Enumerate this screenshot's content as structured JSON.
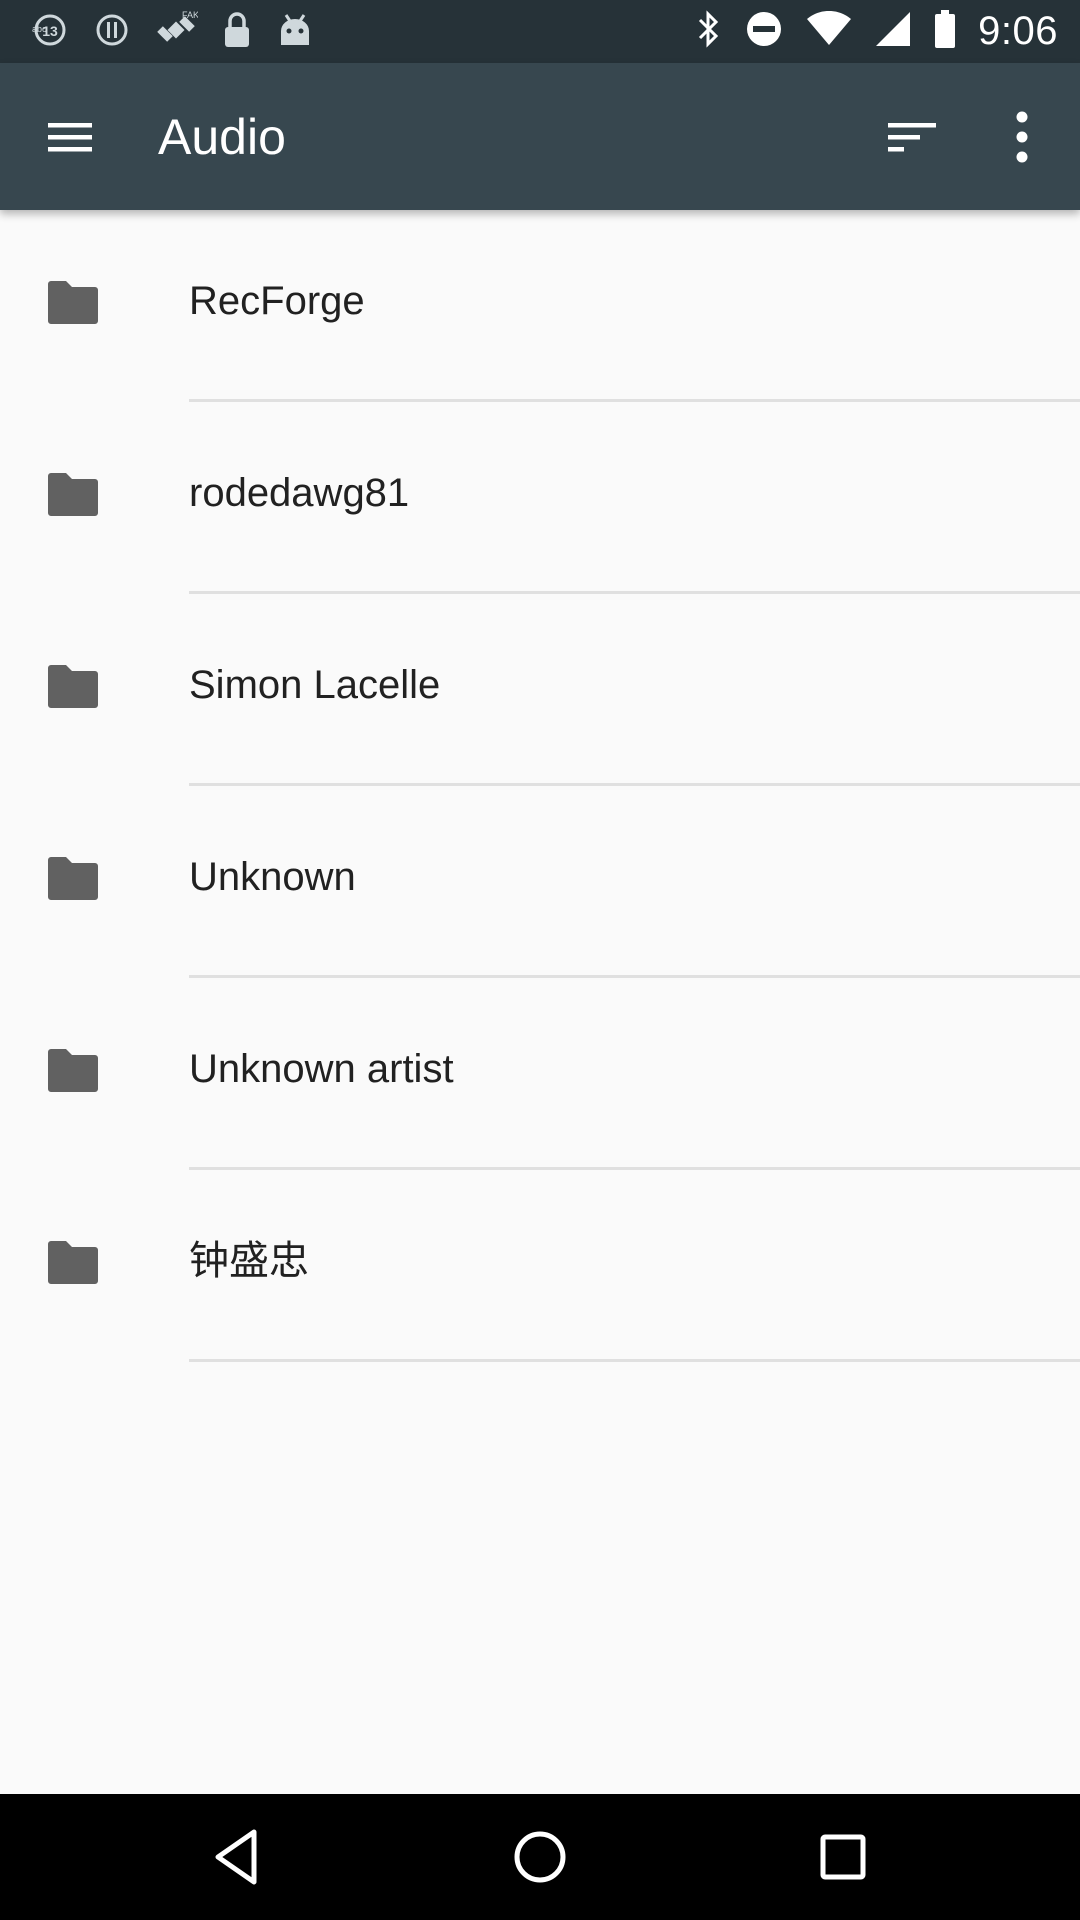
{
  "status_bar": {
    "time": "9:06",
    "left_icons": [
      "abc13-news-icon",
      "alert-circle-icon",
      "fake-gps-satellite-icon",
      "lock-icon",
      "android-icon"
    ],
    "right_icons": [
      "bluetooth-icon",
      "do-not-disturb-icon",
      "wifi-icon",
      "cellular-signal-icon",
      "battery-icon"
    ]
  },
  "app_bar": {
    "title": "Audio",
    "background": "#37474f"
  },
  "folders": [
    {
      "label": "RecForge"
    },
    {
      "label": "rodedawg81"
    },
    {
      "label": "Simon Lacelle"
    },
    {
      "label": "Unknown"
    },
    {
      "label": "Unknown artist"
    },
    {
      "label": "钟盛忠"
    }
  ],
  "colors": {
    "status_bar": "#263238",
    "list_background": "#fafafa",
    "folder_icon": "#616161",
    "text": "#212121",
    "divider": "#e0e0e0"
  }
}
